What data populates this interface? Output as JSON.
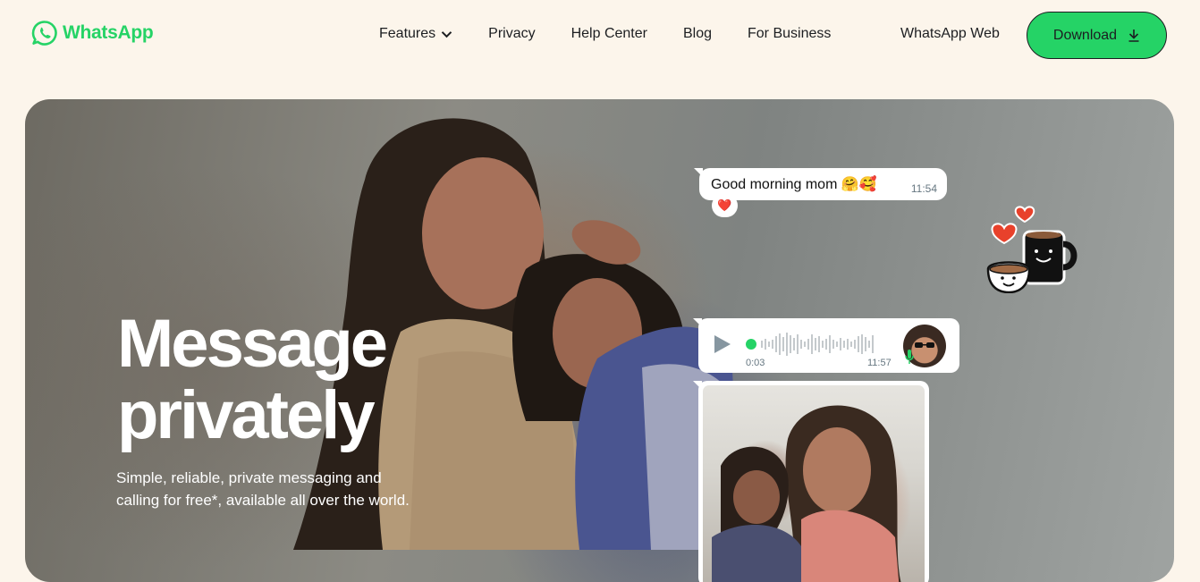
{
  "brand": {
    "name": "WhatsApp",
    "color": "#25d366"
  },
  "nav": {
    "links": [
      {
        "label": "Features",
        "has_dropdown": true
      },
      {
        "label": "Privacy"
      },
      {
        "label": "Help Center"
      },
      {
        "label": "Blog"
      },
      {
        "label": "For Business"
      }
    ],
    "web_link": "WhatsApp Web",
    "download_label": "Download"
  },
  "hero": {
    "title_line1": "Message",
    "title_line2": "privately",
    "subtitle": "Simple, reliable, private messaging and calling for free*, available all over the world."
  },
  "chat": {
    "text_message": "Good morning mom 🤗🥰",
    "text_time": "11:54",
    "reaction": "❤️",
    "voice_elapsed": "0:03",
    "voice_time": "11:57"
  },
  "colors": {
    "background": "#fcf5eb",
    "accent": "#25d366",
    "text": "#1c1e21"
  }
}
